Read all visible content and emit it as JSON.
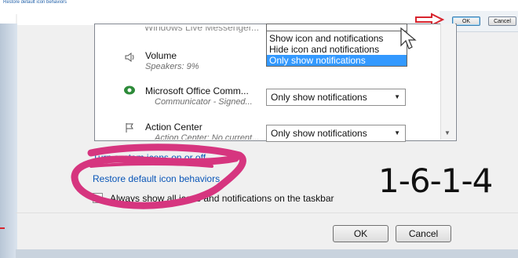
{
  "top_caption": "Restore default icon behaviors",
  "top_buttons": {
    "ok": "OK",
    "cancel": "Cancel"
  },
  "list": {
    "items": [
      {
        "name": "Windows Live Messenger...",
        "subtitle": "",
        "icon": "messenger-icon"
      },
      {
        "name": "Volume",
        "subtitle": "Speakers: 9%",
        "icon": "speaker-icon"
      },
      {
        "name": "Microsoft Office Comm...",
        "subtitle": "Communicator - Signed...",
        "icon": "communicator-icon",
        "behavior": "Only show notifications"
      },
      {
        "name": "Action Center",
        "subtitle": "Action Center: No current...",
        "icon": "flag-icon",
        "behavior": "Only show notifications"
      }
    ]
  },
  "dropdown": {
    "options": [
      "Show icon and notifications",
      "Hide icon and notifications",
      "Only show notifications"
    ],
    "selected_index": 2
  },
  "links": {
    "turn_system_icons": "Turn system icons on or off",
    "restore_defaults": "Restore default icon behaviors"
  },
  "checkbox": {
    "label": "Always show all icons and notifications on the taskbar",
    "checked": false
  },
  "annotation_code": "1-6-1-4",
  "footer_buttons": {
    "ok": "OK",
    "cancel": "Cancel"
  },
  "colors": {
    "highlight": "#3399ff",
    "link": "#0a56b8",
    "annotation": "#d6357f",
    "arrow": "#d8242e"
  }
}
